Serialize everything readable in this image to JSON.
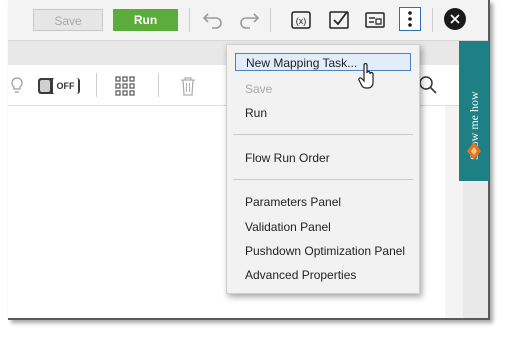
{
  "toolbar": {
    "save_label": "Save",
    "run_label": "Run",
    "icons": [
      "undo-icon",
      "redo-icon",
      "expression-icon",
      "validate-icon",
      "parameter-icon",
      "more-options-icon",
      "close-icon"
    ]
  },
  "subbar": {
    "toggle_label": "OFF"
  },
  "menu": {
    "items": [
      {
        "label": "New Mapping Task...",
        "state": "hover"
      },
      {
        "label": "Save",
        "state": "disabled"
      },
      {
        "label": "Run",
        "state": "enabled"
      },
      {
        "label": "Flow Run Order",
        "state": "enabled"
      },
      {
        "label": "Parameters Panel",
        "state": "enabled"
      },
      {
        "label": "Validation Panel",
        "state": "enabled"
      },
      {
        "label": "Pushdown Optimization Panel",
        "state": "enabled"
      },
      {
        "label": "Advanced Properties",
        "state": "enabled"
      }
    ]
  },
  "showme": {
    "label": "Show me how"
  },
  "colors": {
    "run": "#5cac3c",
    "accent": "#2e6fb3",
    "showme": "#1e7f85",
    "showme_icon": "#e8731f"
  }
}
